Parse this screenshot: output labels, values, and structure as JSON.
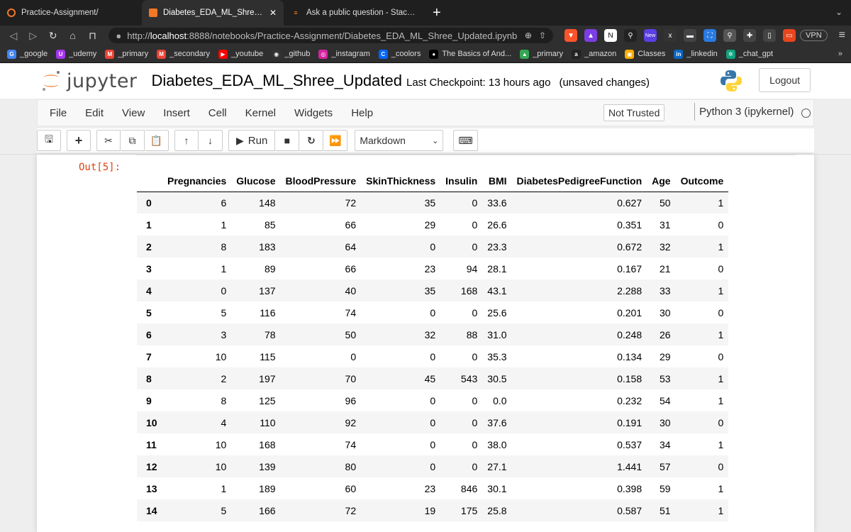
{
  "browser": {
    "tabs": [
      {
        "title": "Practice-Assignment/",
        "active": false
      },
      {
        "title": "Diabetes_EDA_ML_Shree_Updated",
        "active": true
      },
      {
        "title": "Ask a public question - Stack Overflow",
        "active": false
      }
    ],
    "url_prefix": "http://",
    "url_host": "localhost",
    "url_path": ":8888/notebooks/Practice-Assignment/Diabetes_EDA_ML_Shree_Updated.ipynb",
    "vpn_label": "VPN",
    "new_badge": "New",
    "bookmarks": [
      {
        "label": "_google",
        "color": "#4285f4",
        "glyph": "G"
      },
      {
        "label": "_udemy",
        "color": "#a435f0",
        "glyph": "U"
      },
      {
        "label": "_primary",
        "color": "#ea4335",
        "glyph": "M"
      },
      {
        "label": "_secondary",
        "color": "#ea4335",
        "glyph": "M"
      },
      {
        "label": "_youtube",
        "color": "#ff0000",
        "glyph": "▶"
      },
      {
        "label": "_github",
        "color": "#333333",
        "glyph": "◉"
      },
      {
        "label": "_instagram",
        "color": "#d6249f",
        "glyph": "◎"
      },
      {
        "label": "_coolors",
        "color": "#0066ff",
        "glyph": "C"
      },
      {
        "label": "The Basics of And...",
        "color": "#000000",
        "glyph": "●"
      },
      {
        "label": "_primary",
        "color": "#34a853",
        "glyph": "▲"
      },
      {
        "label": "_amazon",
        "color": "#222222",
        "glyph": "a"
      },
      {
        "label": "Classes",
        "color": "#f9ab00",
        "glyph": "▣"
      },
      {
        "label": "_linkedin",
        "color": "#0a66c2",
        "glyph": "in"
      },
      {
        "label": "_chat_gpt",
        "color": "#10a37f",
        "glyph": "✲"
      }
    ],
    "bookmarks_more": "»"
  },
  "jupyter": {
    "logo_text": "jupyter",
    "notebook_name": "Diabetes_EDA_ML_Shree_Updated",
    "checkpoint": "Last Checkpoint: 13 hours ago",
    "unsaved": "(unsaved changes)",
    "logout": "Logout",
    "menu": [
      "File",
      "Edit",
      "View",
      "Insert",
      "Cell",
      "Kernel",
      "Widgets",
      "Help"
    ],
    "trust": "Not Trusted",
    "kernel": "Python 3 (ipykernel)",
    "run_label": "Run",
    "cell_type": "Markdown"
  },
  "output": {
    "prompt": "Out[5]:",
    "columns": [
      "",
      "Pregnancies",
      "Glucose",
      "BloodPressure",
      "SkinThickness",
      "Insulin",
      "BMI",
      "DiabetesPedigreeFunction",
      "Age",
      "Outcome"
    ],
    "rows": [
      [
        "0",
        "6",
        "148",
        "72",
        "35",
        "0",
        "33.6",
        "0.627",
        "50",
        "1"
      ],
      [
        "1",
        "1",
        "85",
        "66",
        "29",
        "0",
        "26.6",
        "0.351",
        "31",
        "0"
      ],
      [
        "2",
        "8",
        "183",
        "64",
        "0",
        "0",
        "23.3",
        "0.672",
        "32",
        "1"
      ],
      [
        "3",
        "1",
        "89",
        "66",
        "23",
        "94",
        "28.1",
        "0.167",
        "21",
        "0"
      ],
      [
        "4",
        "0",
        "137",
        "40",
        "35",
        "168",
        "43.1",
        "2.288",
        "33",
        "1"
      ],
      [
        "5",
        "5",
        "116",
        "74",
        "0",
        "0",
        "25.6",
        "0.201",
        "30",
        "0"
      ],
      [
        "6",
        "3",
        "78",
        "50",
        "32",
        "88",
        "31.0",
        "0.248",
        "26",
        "1"
      ],
      [
        "7",
        "10",
        "115",
        "0",
        "0",
        "0",
        "35.3",
        "0.134",
        "29",
        "0"
      ],
      [
        "8",
        "2",
        "197",
        "70",
        "45",
        "543",
        "30.5",
        "0.158",
        "53",
        "1"
      ],
      [
        "9",
        "8",
        "125",
        "96",
        "0",
        "0",
        "0.0",
        "0.232",
        "54",
        "1"
      ],
      [
        "10",
        "4",
        "110",
        "92",
        "0",
        "0",
        "37.6",
        "0.191",
        "30",
        "0"
      ],
      [
        "11",
        "10",
        "168",
        "74",
        "0",
        "0",
        "38.0",
        "0.537",
        "34",
        "1"
      ],
      [
        "12",
        "10",
        "139",
        "80",
        "0",
        "0",
        "27.1",
        "1.441",
        "57",
        "0"
      ],
      [
        "13",
        "1",
        "189",
        "60",
        "23",
        "846",
        "30.1",
        "0.398",
        "59",
        "1"
      ],
      [
        "14",
        "5",
        "166",
        "72",
        "19",
        "175",
        "25.8",
        "0.587",
        "51",
        "1"
      ]
    ]
  }
}
